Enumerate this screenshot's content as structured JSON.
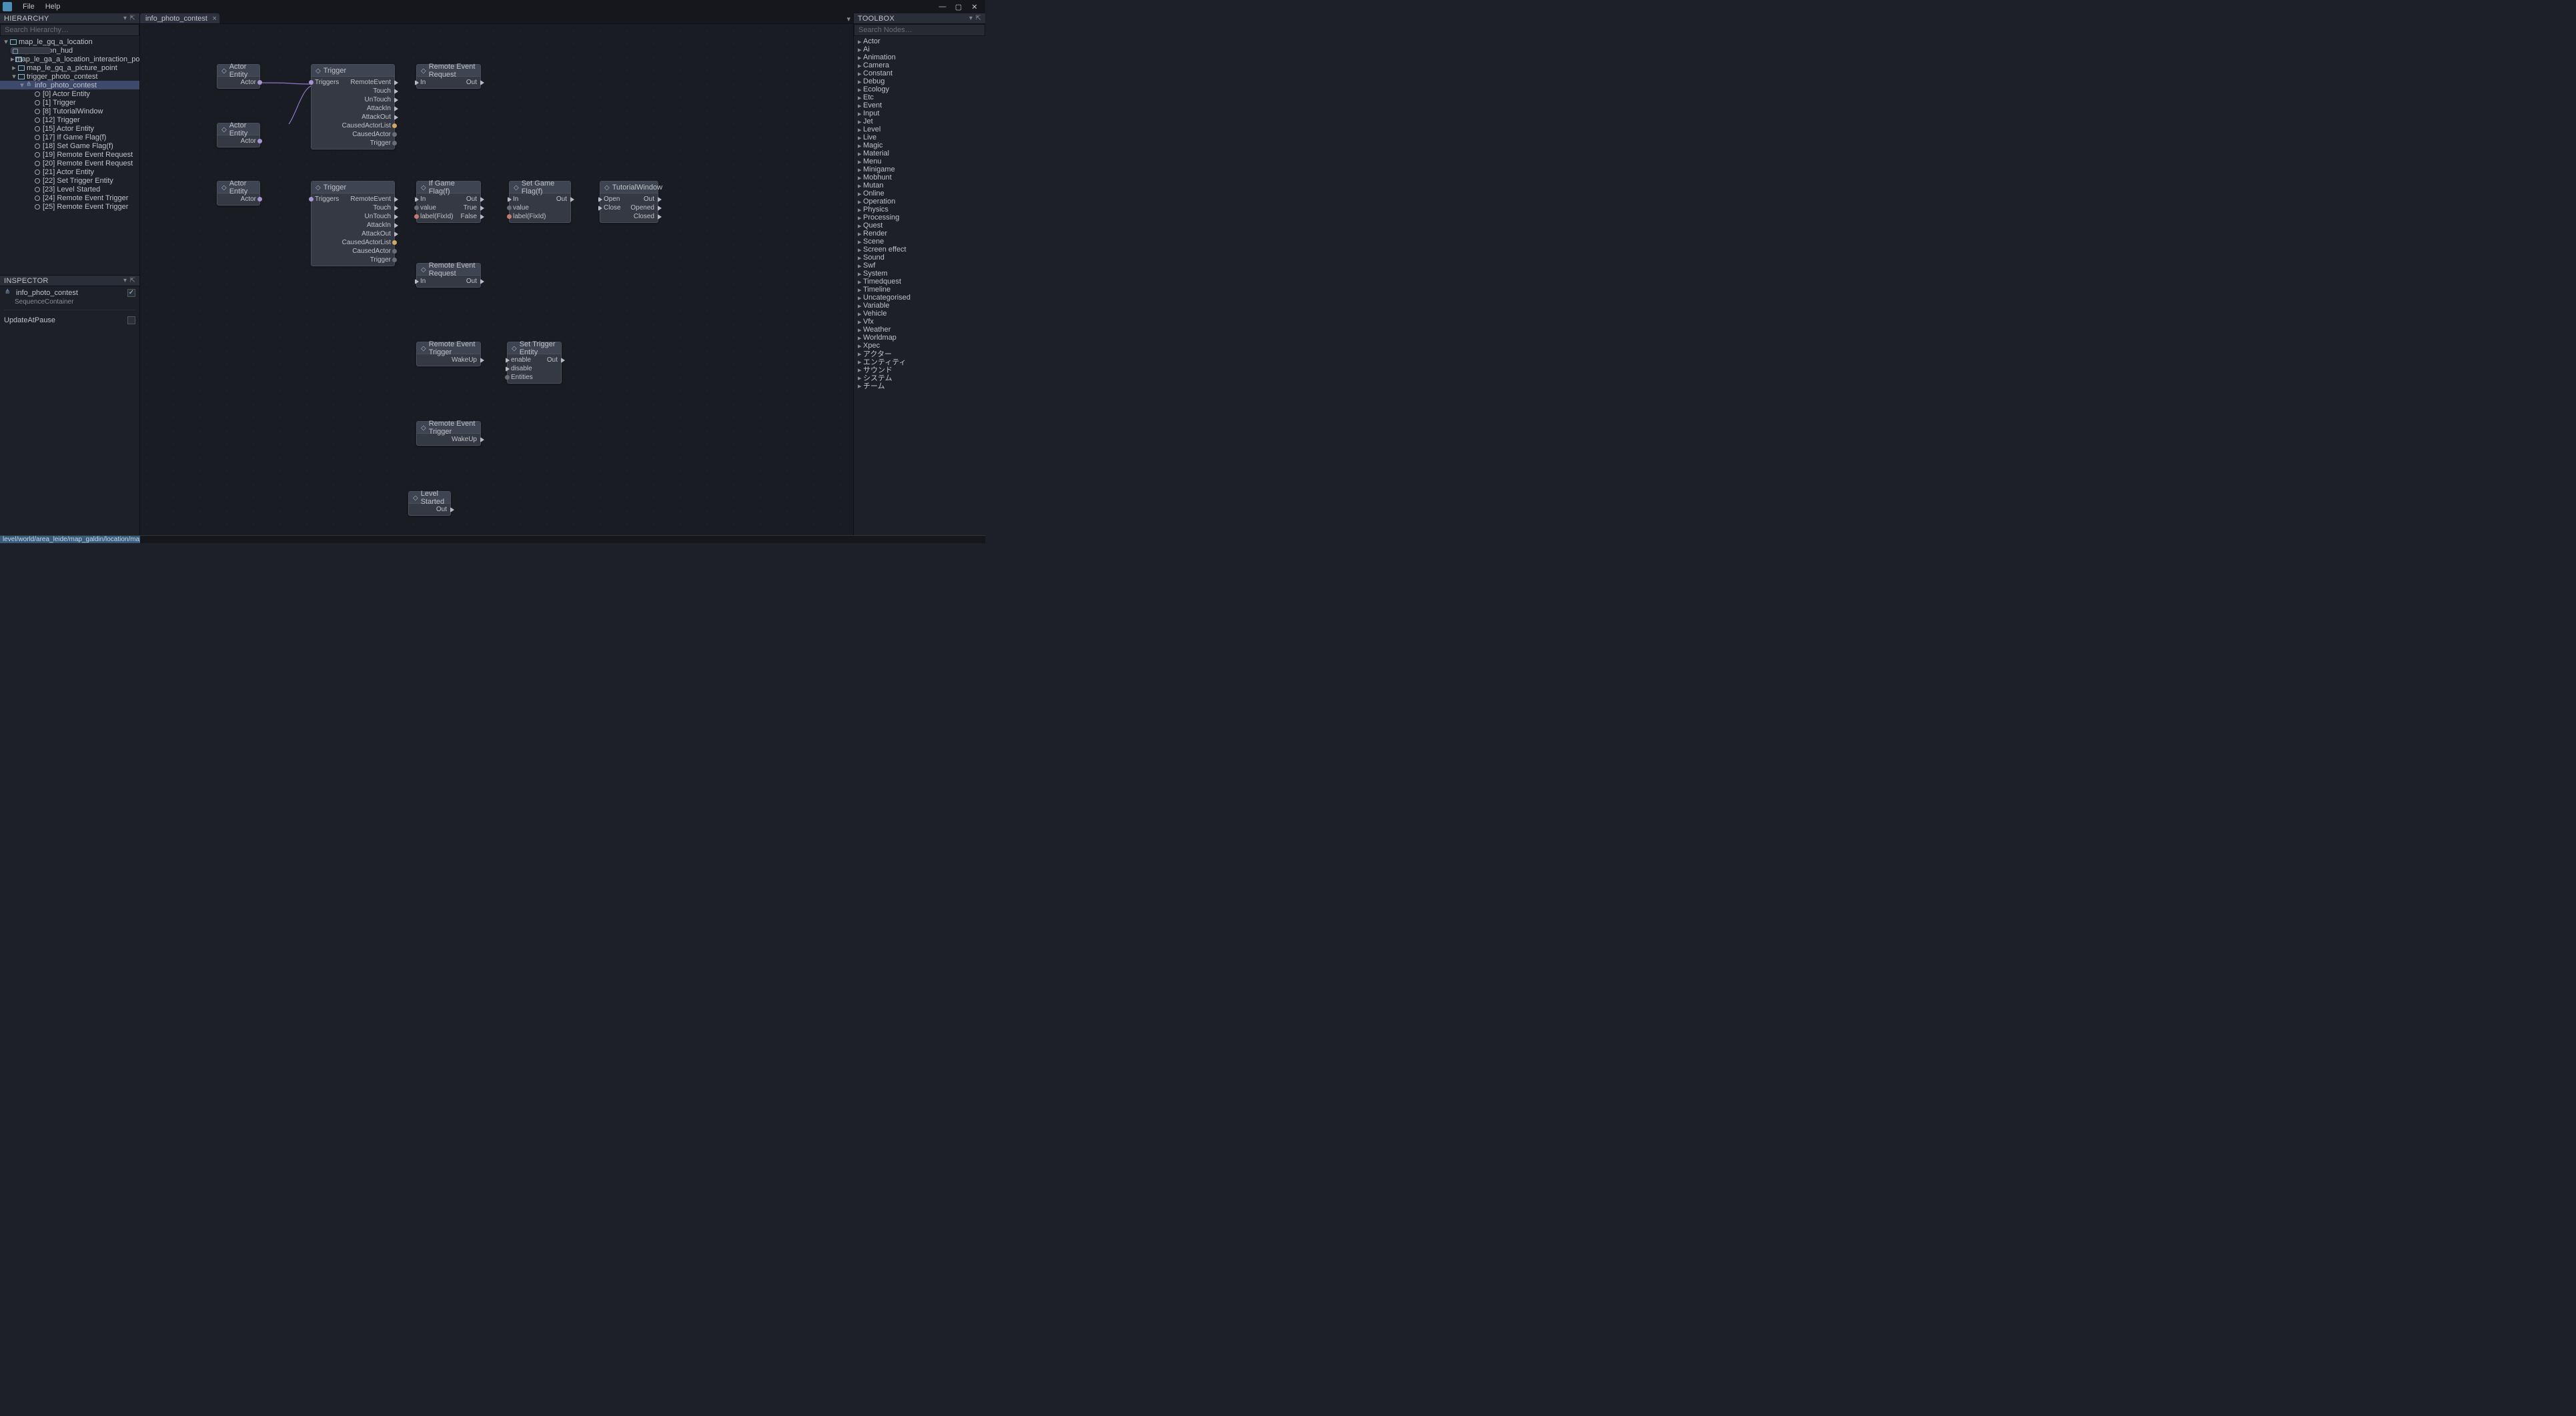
{
  "menu": {
    "file": "File",
    "help": "Help"
  },
  "panels": {
    "hierarchy": "HIERARCHY",
    "inspector": "INSPECTOR",
    "toolbox": "TOOLBOX"
  },
  "search": {
    "hierarchy_ph": "Search Hierarchy…",
    "nodes_ph": "Search Nodes…"
  },
  "tab": {
    "active": "info_photo_contest"
  },
  "status_path": "level/world/area_leide/map_galdin/location/map_le_gq_a_locati",
  "hierarchy": [
    {
      "depth": 0,
      "tw": "▾",
      "ic": "folder",
      "label": "map_le_gq_a_location"
    },
    {
      "depth": 1,
      "tw": "",
      "ic": "node",
      "label": "UI_Location_hud"
    },
    {
      "depth": 1,
      "tw": "▸",
      "ic": "folder",
      "label": "map_le_ga_a_location_interaction_point"
    },
    {
      "depth": 1,
      "tw": "▸",
      "ic": "folder",
      "label": "map_le_gq_a_picture_point"
    },
    {
      "depth": 1,
      "tw": "▾",
      "ic": "folder",
      "label": "trigger_photo_contest"
    },
    {
      "depth": 2,
      "tw": "▾",
      "ic": "share",
      "label": "info_photo_contest",
      "selected": true
    },
    {
      "depth": 3,
      "tw": "",
      "ic": "circ",
      "label": "[0] Actor Entity"
    },
    {
      "depth": 3,
      "tw": "",
      "ic": "circ",
      "label": "[1] Trigger"
    },
    {
      "depth": 3,
      "tw": "",
      "ic": "circ",
      "label": "[8] TutorialWindow"
    },
    {
      "depth": 3,
      "tw": "",
      "ic": "circ",
      "label": "[12] Trigger"
    },
    {
      "depth": 3,
      "tw": "",
      "ic": "circ",
      "label": "[15] Actor Entity"
    },
    {
      "depth": 3,
      "tw": "",
      "ic": "circ",
      "label": "[17] If Game Flag(f)"
    },
    {
      "depth": 3,
      "tw": "",
      "ic": "circ",
      "label": "[18] Set Game Flag(f)"
    },
    {
      "depth": 3,
      "tw": "",
      "ic": "circ",
      "label": "[19] Remote Event Request"
    },
    {
      "depth": 3,
      "tw": "",
      "ic": "circ",
      "label": "[20] Remote Event Request"
    },
    {
      "depth": 3,
      "tw": "",
      "ic": "circ",
      "label": "[21] Actor Entity"
    },
    {
      "depth": 3,
      "tw": "",
      "ic": "circ",
      "label": "[22] Set Trigger Entity"
    },
    {
      "depth": 3,
      "tw": "",
      "ic": "circ",
      "label": "[23] Level Started"
    },
    {
      "depth": 3,
      "tw": "",
      "ic": "circ",
      "label": "[24] Remote Event Trigger"
    },
    {
      "depth": 3,
      "tw": "",
      "ic": "circ",
      "label": "[25] Remote Event Trigger"
    }
  ],
  "inspector": {
    "name": "info_photo_contest",
    "type": "SequenceContainer",
    "prop1_label": "UpdateAtPause"
  },
  "toolbox": [
    "Actor",
    "Ai",
    "Animation",
    "Camera",
    "Constant",
    "Debug",
    "Ecology",
    "Etc",
    "Event",
    "Input",
    "Jet",
    "Level",
    "Live",
    "Magic",
    "Material",
    "Menu",
    "Minigame",
    "Mobhunt",
    "Mutan",
    "Online",
    "Operation",
    "Physics",
    "Processing",
    "Quest",
    "Render",
    "Scene",
    "Screen effect",
    "Sound",
    "Swf",
    "System",
    "Timedquest",
    "Timeline",
    "Uncategorised",
    "Variable",
    "Vehicle",
    "Vfx",
    "Weather",
    "Worldmap",
    "Xpec",
    "アクター",
    "エンティティ",
    "サウンド",
    "システム",
    "チーム"
  ],
  "nodes": {
    "actor1": {
      "title": "Actor Entity",
      "port_actor": "Actor"
    },
    "actor2": {
      "title": "Actor Entity",
      "port_actor": "Actor"
    },
    "actor3": {
      "title": "Actor Entity",
      "port_actor": "Actor"
    },
    "trigger1": {
      "title": "Trigger",
      "p_triggers": "Triggers",
      "p_remote": "RemoteEvent",
      "p_touch": "Touch",
      "p_untouch": "UnTouch",
      "p_atkin": "AttackIn",
      "p_atkout": "AttackOut",
      "p_cal": "CausedActorList",
      "p_ca": "CausedActor",
      "p_trig": "Trigger"
    },
    "trigger2": {
      "title": "Trigger",
      "p_triggers": "Triggers",
      "p_remote": "RemoteEvent",
      "p_touch": "Touch",
      "p_untouch": "UnTouch",
      "p_atkin": "AttackIn",
      "p_atkout": "AttackOut",
      "p_cal": "CausedActorList",
      "p_ca": "CausedActor",
      "p_trig": "Trigger"
    },
    "rer1": {
      "title": "Remote Event Request",
      "p_in": "In",
      "p_out": "Out"
    },
    "rer2": {
      "title": "Remote Event Request",
      "p_in": "In",
      "p_out": "Out"
    },
    "ifflag": {
      "title": "If Game Flag(f)",
      "p_in": "In",
      "p_out": "Out",
      "p_value": "value",
      "p_true": "True",
      "p_label": "label(FixId)",
      "p_false": "False"
    },
    "setflag": {
      "title": "Set Game Flag(f)",
      "p_in": "In",
      "p_out": "Out",
      "p_value": "value",
      "p_label": "label(FixId)"
    },
    "tutorial": {
      "title": "TutorialWindow",
      "p_open": "Open",
      "p_out": "Out",
      "p_close": "Close",
      "p_opened": "Opened",
      "p_closed": "Closed"
    },
    "ret1": {
      "title": "Remote Event Trigger",
      "p_wake": "WakeUp"
    },
    "ret2": {
      "title": "Remote Event Trigger",
      "p_wake": "WakeUp"
    },
    "settrig": {
      "title": "Set Trigger Entity",
      "p_enable": "enable",
      "p_out": "Out",
      "p_disable": "disable",
      "p_ent": "Entities"
    },
    "level": {
      "title": "Level Started",
      "p_out": "Out"
    }
  }
}
